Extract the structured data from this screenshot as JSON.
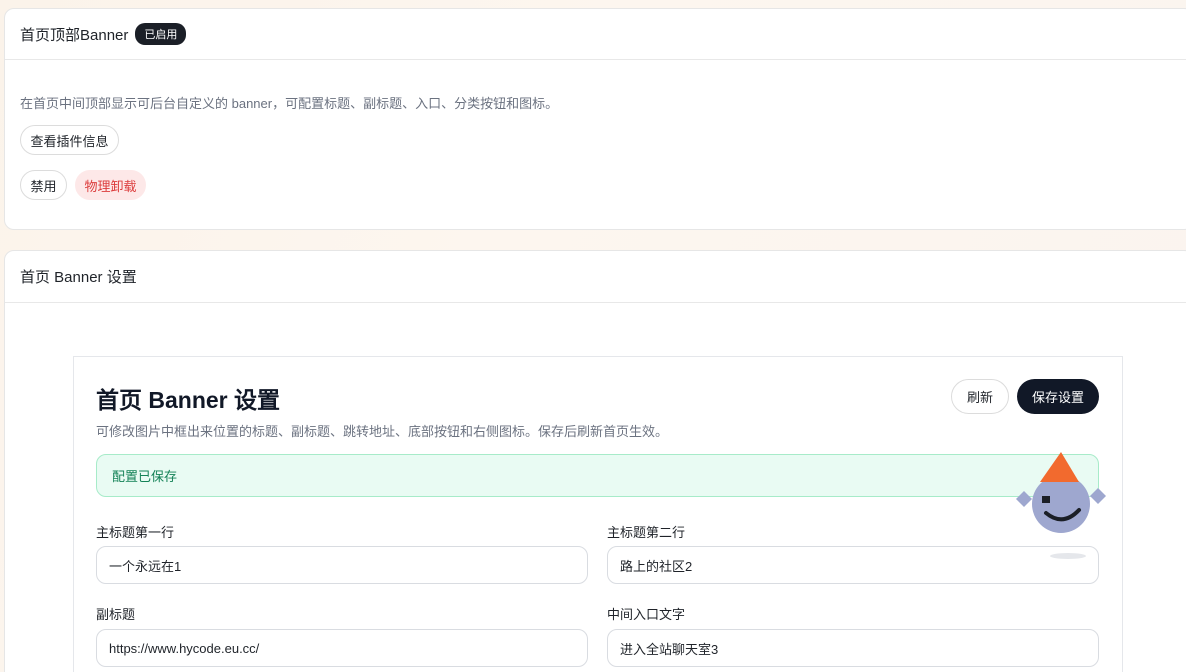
{
  "plugin": {
    "name": "首页顶部Banner",
    "status_badge": "已启用",
    "description": "在首页中间顶部显示可后台自定义的 banner，可配置标题、副标题、入口、分类按钮和图标。",
    "buttons": {
      "info": "查看插件信息",
      "disable": "禁用",
      "uninstall": "物理卸载"
    }
  },
  "settings_card": {
    "title": "首页 Banner 设置"
  },
  "panel": {
    "title": "首页 Banner 设置",
    "subtitle": "可修改图片中框出来位置的标题、副标题、跳转地址、底部按钮和右侧图标。保存后刷新首页生效。",
    "refresh_label": "刷新",
    "save_label": "保存设置",
    "alert": "配置已保存",
    "fields": {
      "title_line1": {
        "label": "主标题第一行",
        "value": "一个永远在1"
      },
      "title_line2": {
        "label": "主标题第二行",
        "value": "路上的社区2"
      },
      "subtitle": {
        "label": "副标题",
        "value": "https://www.hycode.eu.cc/"
      },
      "entry_text": {
        "label": "中间入口文字",
        "value": "进入全站聊天室3"
      }
    }
  },
  "colors": {
    "accent_dark": "#111827",
    "success_bg": "#e9fbf3",
    "success_text": "#148257",
    "danger_bg": "#fde8e8",
    "danger_text": "#dc3b3b",
    "mascot_body": "#9ea7cf",
    "mascot_hat": "#f26a2e"
  }
}
